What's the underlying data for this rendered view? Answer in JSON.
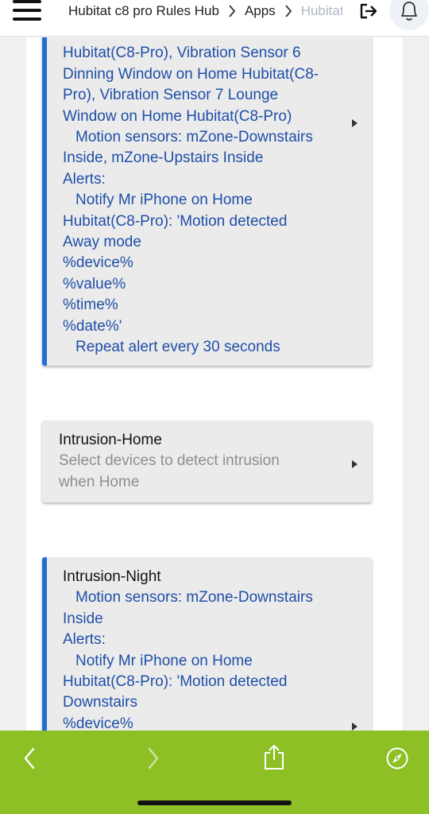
{
  "header": {
    "breadcrumb": [
      "Hubitat c8 pro Rules Hub",
      "Apps",
      "Hubitat"
    ],
    "menu_icon": "hamburger-menu-icon",
    "logout_icon": "logout-icon",
    "notifications_icon": "bell-icon"
  },
  "cards": {
    "first": {
      "lines": [
        "Hubitat(C8-Pro), Vibration Sensor 6",
        "Dinning Window on Home Hubitat(C8-",
        "Pro), Vibration Sensor 7 Lounge",
        "Window on Home Hubitat(C8-Pro)",
        "Motion sensors: mZone-Downstairs",
        "Inside, mZone-Upstairs Inside",
        "Alerts:",
        "Notify Mr iPhone on Home",
        "Hubitat(C8-Pro): 'Motion detected",
        "Away mode",
        "%device%",
        "%value%",
        "%time%",
        "%date%'",
        "Repeat alert every 30 seconds"
      ]
    },
    "home": {
      "title": "Intrusion-Home",
      "description_lines": [
        "Select devices to detect intrusion",
        "when Home"
      ]
    },
    "night": {
      "title": "Intrusion-Night",
      "lines": [
        "Motion sensors: mZone-Downstairs",
        "Inside",
        "Alerts:",
        "Notify Mr iPhone on Home",
        "Hubitat(C8-Pro): 'Motion detected",
        "Downstairs",
        "%device%"
      ]
    }
  },
  "toolbar": {
    "back_icon": "chevron-left-icon",
    "forward_icon": "chevron-right-icon",
    "share_icon": "share-icon",
    "compass_icon": "compass-icon",
    "background_color": "#8dc025"
  },
  "colors": {
    "accent": "#1e70d6",
    "link_text": "#1f4fa8",
    "muted_text": "#8e8e8e"
  }
}
